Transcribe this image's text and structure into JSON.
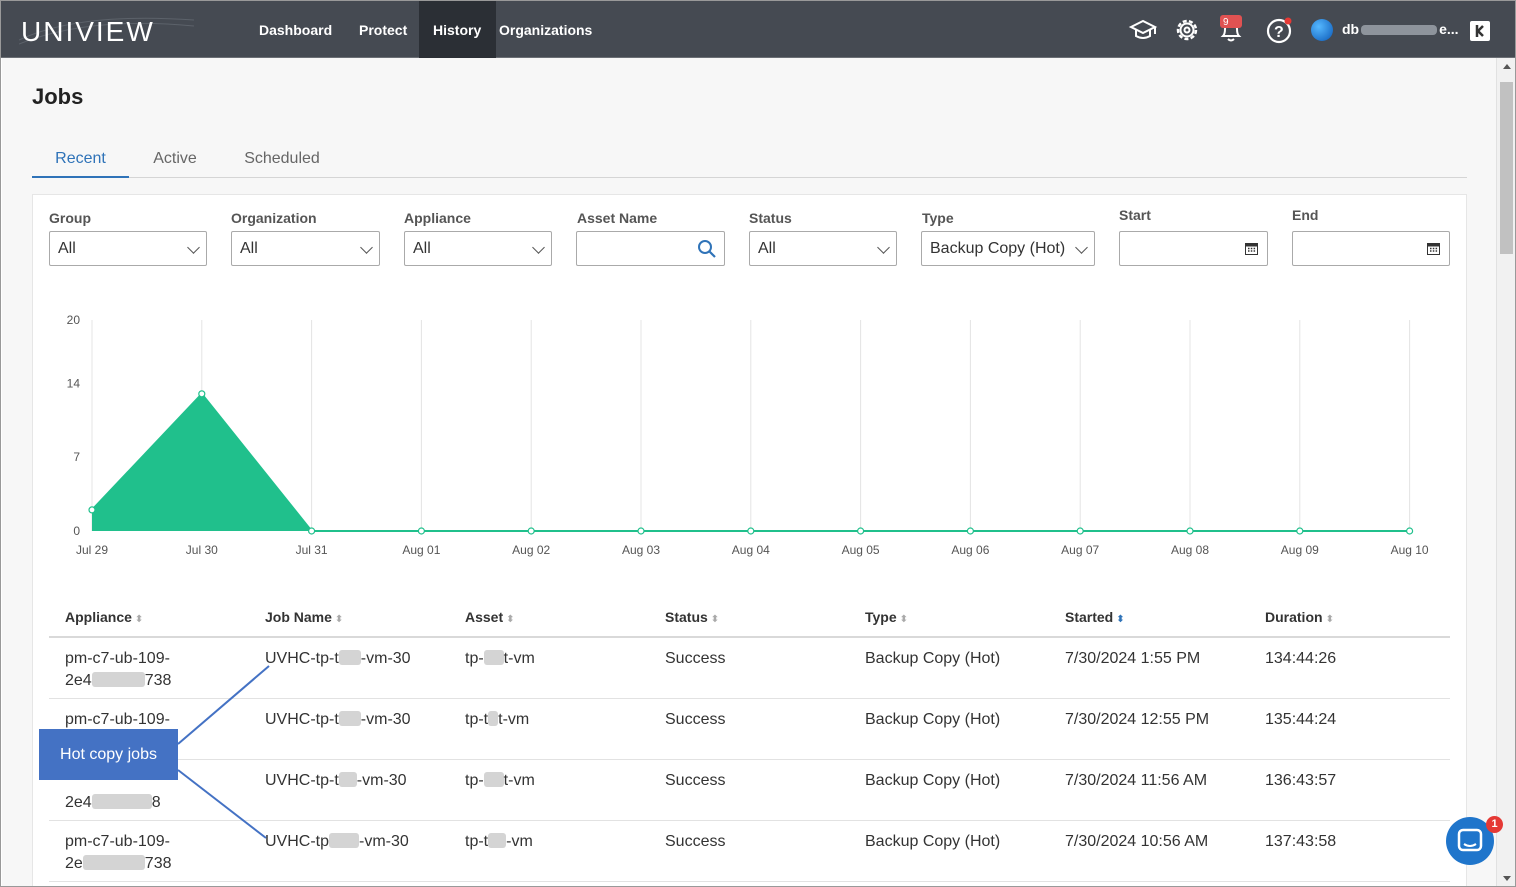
{
  "nav": {
    "brand": "UNIVIEW",
    "items": [
      {
        "label": "Dashboard",
        "active": false
      },
      {
        "label": "Protect",
        "active": false
      },
      {
        "label": "History",
        "active": true
      },
      {
        "label": "Organizations",
        "active": false
      }
    ],
    "icons": [
      "graduation-cap-icon",
      "gear-icon",
      "notifications-icon",
      "help-icon"
    ],
    "notification_count": "9",
    "user_prefix": "db",
    "user_suffix": "e..."
  },
  "page": {
    "title": "Jobs",
    "tabs": [
      {
        "label": "Recent",
        "active": true
      },
      {
        "label": "Active",
        "active": false
      },
      {
        "label": "Scheduled",
        "active": false
      }
    ]
  },
  "filters": {
    "group": {
      "label": "Group",
      "value": "All"
    },
    "organization": {
      "label": "Organization",
      "value": "All"
    },
    "appliance": {
      "label": "Appliance",
      "value": "All"
    },
    "asset_name": {
      "label": "Asset Name",
      "value": ""
    },
    "status": {
      "label": "Status",
      "value": "All"
    },
    "type": {
      "label": "Type",
      "value": "Backup Copy (Hot)"
    },
    "start": {
      "label": "Start",
      "value": ""
    },
    "end": {
      "label": "End",
      "value": ""
    }
  },
  "chart_data": {
    "type": "area",
    "x": [
      "Jul 29",
      "Jul 30",
      "Jul 31",
      "Aug 01",
      "Aug 02",
      "Aug 03",
      "Aug 04",
      "Aug 05",
      "Aug 06",
      "Aug 07",
      "Aug 08",
      "Aug 09",
      "Aug 10"
    ],
    "values": [
      2,
      13,
      0,
      0,
      0,
      0,
      0,
      0,
      0,
      0,
      0,
      0,
      0
    ],
    "yticks": [
      0,
      7,
      14,
      20
    ],
    "ylim": [
      0,
      20
    ],
    "color": "#20c08c",
    "grid": "vertical"
  },
  "table": {
    "columns": [
      "Appliance",
      "Job Name",
      "Asset",
      "Status",
      "Type",
      "Started",
      "Duration"
    ],
    "rows": [
      {
        "appliance_1": "pm-c7-ub-109-",
        "appliance_2a": "2e4",
        "appliance_2b": "738",
        "job_a": "UVHC-tp-t",
        "job_b": "-vm-30",
        "asset_a": "tp-",
        "asset_b": "t-vm",
        "status": "Success",
        "type": "Backup Copy (Hot)",
        "started": "7/30/2024 1:55 PM",
        "duration": "134:44:26"
      },
      {
        "appliance_1": "pm-c7-ub-109-",
        "appliance_2a": "",
        "appliance_2b": "",
        "job_a": "UVHC-tp-t",
        "job_b": "-vm-30",
        "asset_a": "tp-t",
        "asset_b": "t-vm",
        "status": "Success",
        "type": "Backup Copy (Hot)",
        "started": "7/30/2024 12:55 PM",
        "duration": "135:44:24"
      },
      {
        "appliance_1": "",
        "appliance_2a": "2e4",
        "appliance_2b": "8",
        "job_a": "UVHC-tp-t",
        "job_b": "-vm-30",
        "asset_a": "tp-",
        "asset_b": "t-vm",
        "status": "Success",
        "type": "Backup Copy (Hot)",
        "started": "7/30/2024 11:56 AM",
        "duration": "136:43:57"
      },
      {
        "appliance_1": "pm-c7-ub-109-",
        "appliance_2a": "2e",
        "appliance_2b": "738",
        "job_a": "UVHC-tp",
        "job_b": "-vm-30",
        "asset_a": "tp-t",
        "asset_b": "-vm",
        "status": "Success",
        "type": "Backup Copy (Hot)",
        "started": "7/30/2024 10:56 AM",
        "duration": "137:43:58"
      }
    ]
  },
  "callout": {
    "text": "Hot copy jobs"
  },
  "chat": {
    "badge": "1"
  }
}
